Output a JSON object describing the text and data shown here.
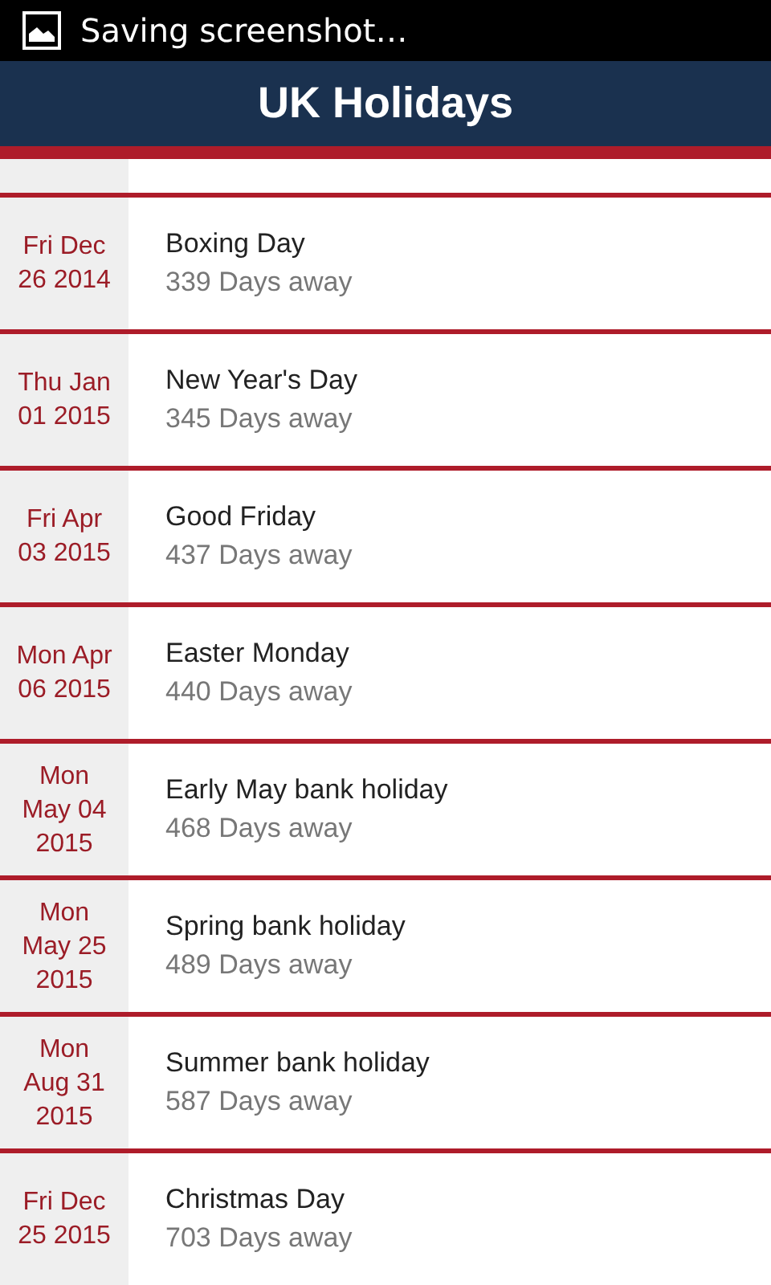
{
  "status_bar": {
    "notification": "Saving screenshot…"
  },
  "header": {
    "title": "UK Holidays"
  },
  "holidays": [
    {
      "date_lines": [
        "Fri Dec",
        "26 2014"
      ],
      "name": "Boxing Day",
      "countdown": "339 Days away"
    },
    {
      "date_lines": [
        "Thu Jan",
        "01 2015"
      ],
      "name": "New Year's Day",
      "countdown": "345 Days away"
    },
    {
      "date_lines": [
        "Fri Apr",
        "03 2015"
      ],
      "name": "Good Friday",
      "countdown": "437 Days away"
    },
    {
      "date_lines": [
        "Mon Apr",
        "06 2015"
      ],
      "name": "Easter Monday",
      "countdown": "440 Days away"
    },
    {
      "date_lines": [
        "Mon",
        "May 04",
        "2015"
      ],
      "name": "Early May bank holiday",
      "countdown": "468 Days away"
    },
    {
      "date_lines": [
        "Mon",
        "May 25",
        "2015"
      ],
      "name": "Spring bank holiday",
      "countdown": "489 Days away"
    },
    {
      "date_lines": [
        "Mon",
        "Aug 31",
        "2015"
      ],
      "name": "Summer bank holiday",
      "countdown": "587 Days away"
    },
    {
      "date_lines": [
        "Fri Dec",
        "25 2015"
      ],
      "name": "Christmas Day",
      "countdown": "703 Days away"
    }
  ]
}
